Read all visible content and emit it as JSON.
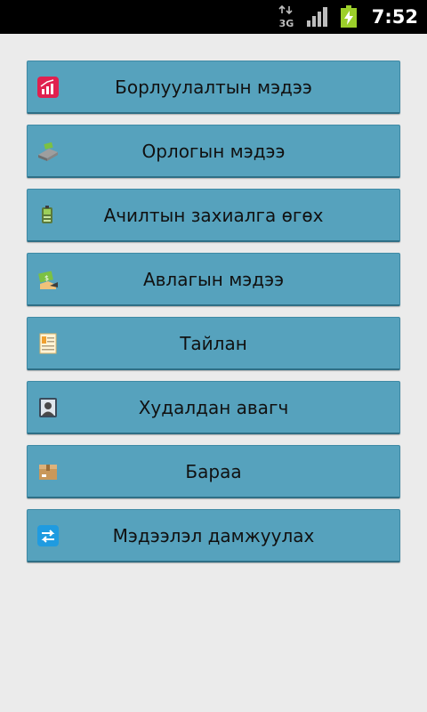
{
  "status_bar": {
    "network": "3G",
    "time": "7:52"
  },
  "menu": [
    {
      "label": "Борлуулалтын мэдээ",
      "icon": "sales-chart-icon"
    },
    {
      "label": "Орлогын мэдээ",
      "icon": "income-device-icon"
    },
    {
      "label": "Ачилтын захиалга өгөх",
      "icon": "shipping-order-icon"
    },
    {
      "label": "Авлагын мэдээ",
      "icon": "receivables-icon"
    },
    {
      "label": "Тайлан",
      "icon": "report-icon"
    },
    {
      "label": "Худалдан авагч",
      "icon": "customer-icon"
    },
    {
      "label": "Бараа",
      "icon": "product-box-icon"
    },
    {
      "label": "Мэдээлэл дамжуулах",
      "icon": "data-transfer-icon"
    }
  ]
}
